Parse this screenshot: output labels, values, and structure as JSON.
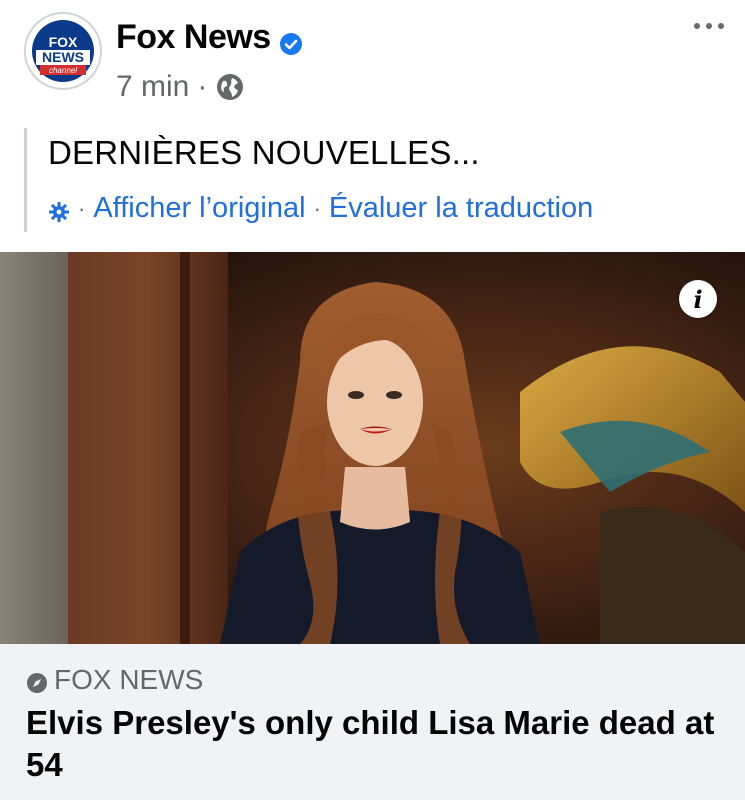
{
  "post": {
    "page_name": "Fox News",
    "time": "7 min",
    "meta_separator": "·",
    "text": "DERNIÈRES NOUVELLES...",
    "translation": {
      "show_original": "Afficher l’original",
      "rate_translation": "Évaluer la traduction",
      "separator": "·"
    }
  },
  "avatar_logo": {
    "line1": "FOX",
    "line2": "NEWS",
    "line3": "channel"
  },
  "link_card": {
    "source": "FOX NEWS",
    "headline": "Elvis Presley's only child Lisa Marie dead at 54"
  },
  "photo": {
    "info_label": "i"
  },
  "icons": {
    "verified": "verified-badge-icon",
    "globe": "globe-icon",
    "more": "more-options-icon",
    "gear": "gear-icon",
    "source": "source-compass-icon",
    "info": "info-icon"
  },
  "colors": {
    "link_blue": "#216fdb",
    "verified_blue": "#1877f2",
    "meta_gray": "#65676b",
    "card_background": "#f0f2f5",
    "fox_blue": "#0b3a8a",
    "fox_red": "#d32f2f"
  }
}
